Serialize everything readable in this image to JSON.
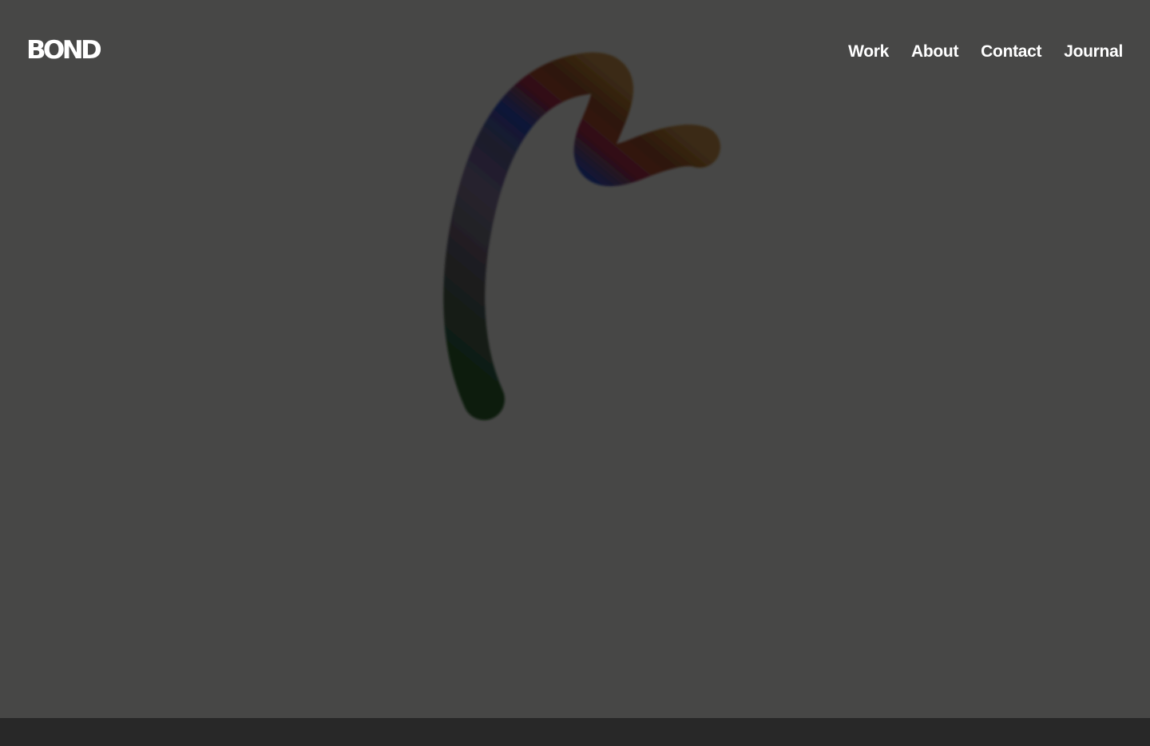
{
  "header": {
    "logo_text": "BOND",
    "nav": [
      {
        "label": "Work"
      },
      {
        "label": "About"
      },
      {
        "label": "Contact"
      },
      {
        "label": "Journal"
      }
    ]
  },
  "colors": {
    "background": "#474746",
    "footer": "#282828",
    "text": "#ffffff",
    "stroke_gradient": [
      "#0b1a0d",
      "#25222a",
      "#1b1a2b",
      "#0e1838",
      "#320f14",
      "#2b1c09"
    ]
  }
}
